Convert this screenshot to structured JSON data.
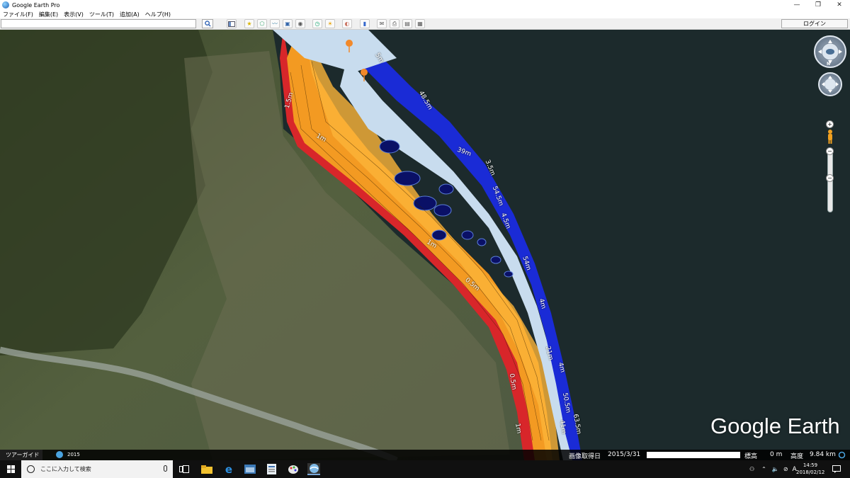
{
  "window": {
    "title": "Google Earth Pro",
    "minimize": "—",
    "maximize": "❐",
    "close": "✕"
  },
  "menu": [
    "ファイル(F)",
    "編集(E)",
    "表示(V)",
    "ツール(T)",
    "追加(A)",
    "ヘルプ(H)"
  ],
  "toolbar": {
    "search_value": "",
    "login_label": "ログイン",
    "icons": [
      "search-icon",
      "sidebar-toggle-icon",
      "placemark-icon",
      "polygon-icon",
      "path-icon",
      "image-overlay-icon",
      "record-tour-icon",
      "historical-imagery-icon",
      "sunlight-icon",
      "planets-icon",
      "ruler-icon",
      "email-icon",
      "print-icon",
      "save-image-icon",
      "view-in-maps-icon"
    ]
  },
  "map": {
    "depth_labels": [
      "5m",
      "48.5m",
      "39m",
      "3.5m",
      "54.5m",
      "4.5m",
      "54m",
      "4m",
      "21m",
      "4m",
      "50.5m",
      "63.5m",
      "41m",
      "1.5m",
      "1m",
      "1m",
      "0.5m",
      "0.5m",
      "1m"
    ],
    "logo": "Google Earth",
    "nav_north": "N"
  },
  "status": {
    "tour_guide": "ツアーガイド",
    "historical_year": "2015",
    "imagery_date_label": "画像取得日",
    "imagery_date": "2015/3/31",
    "elevation_label": "標高",
    "elevation_value": "0 m",
    "eye_alt_label": "高度",
    "eye_alt_value": "9.84 km"
  },
  "taskbar": {
    "search_placeholder": "ここに入力して検索",
    "time": "14:59",
    "date": "2018/02/12"
  },
  "colors": {
    "shallow": "#f2a12a",
    "mid": "#b9d6ec",
    "deep": "#1a2bd6",
    "shore": "#d8262a",
    "lake": "#1d2a2d"
  }
}
